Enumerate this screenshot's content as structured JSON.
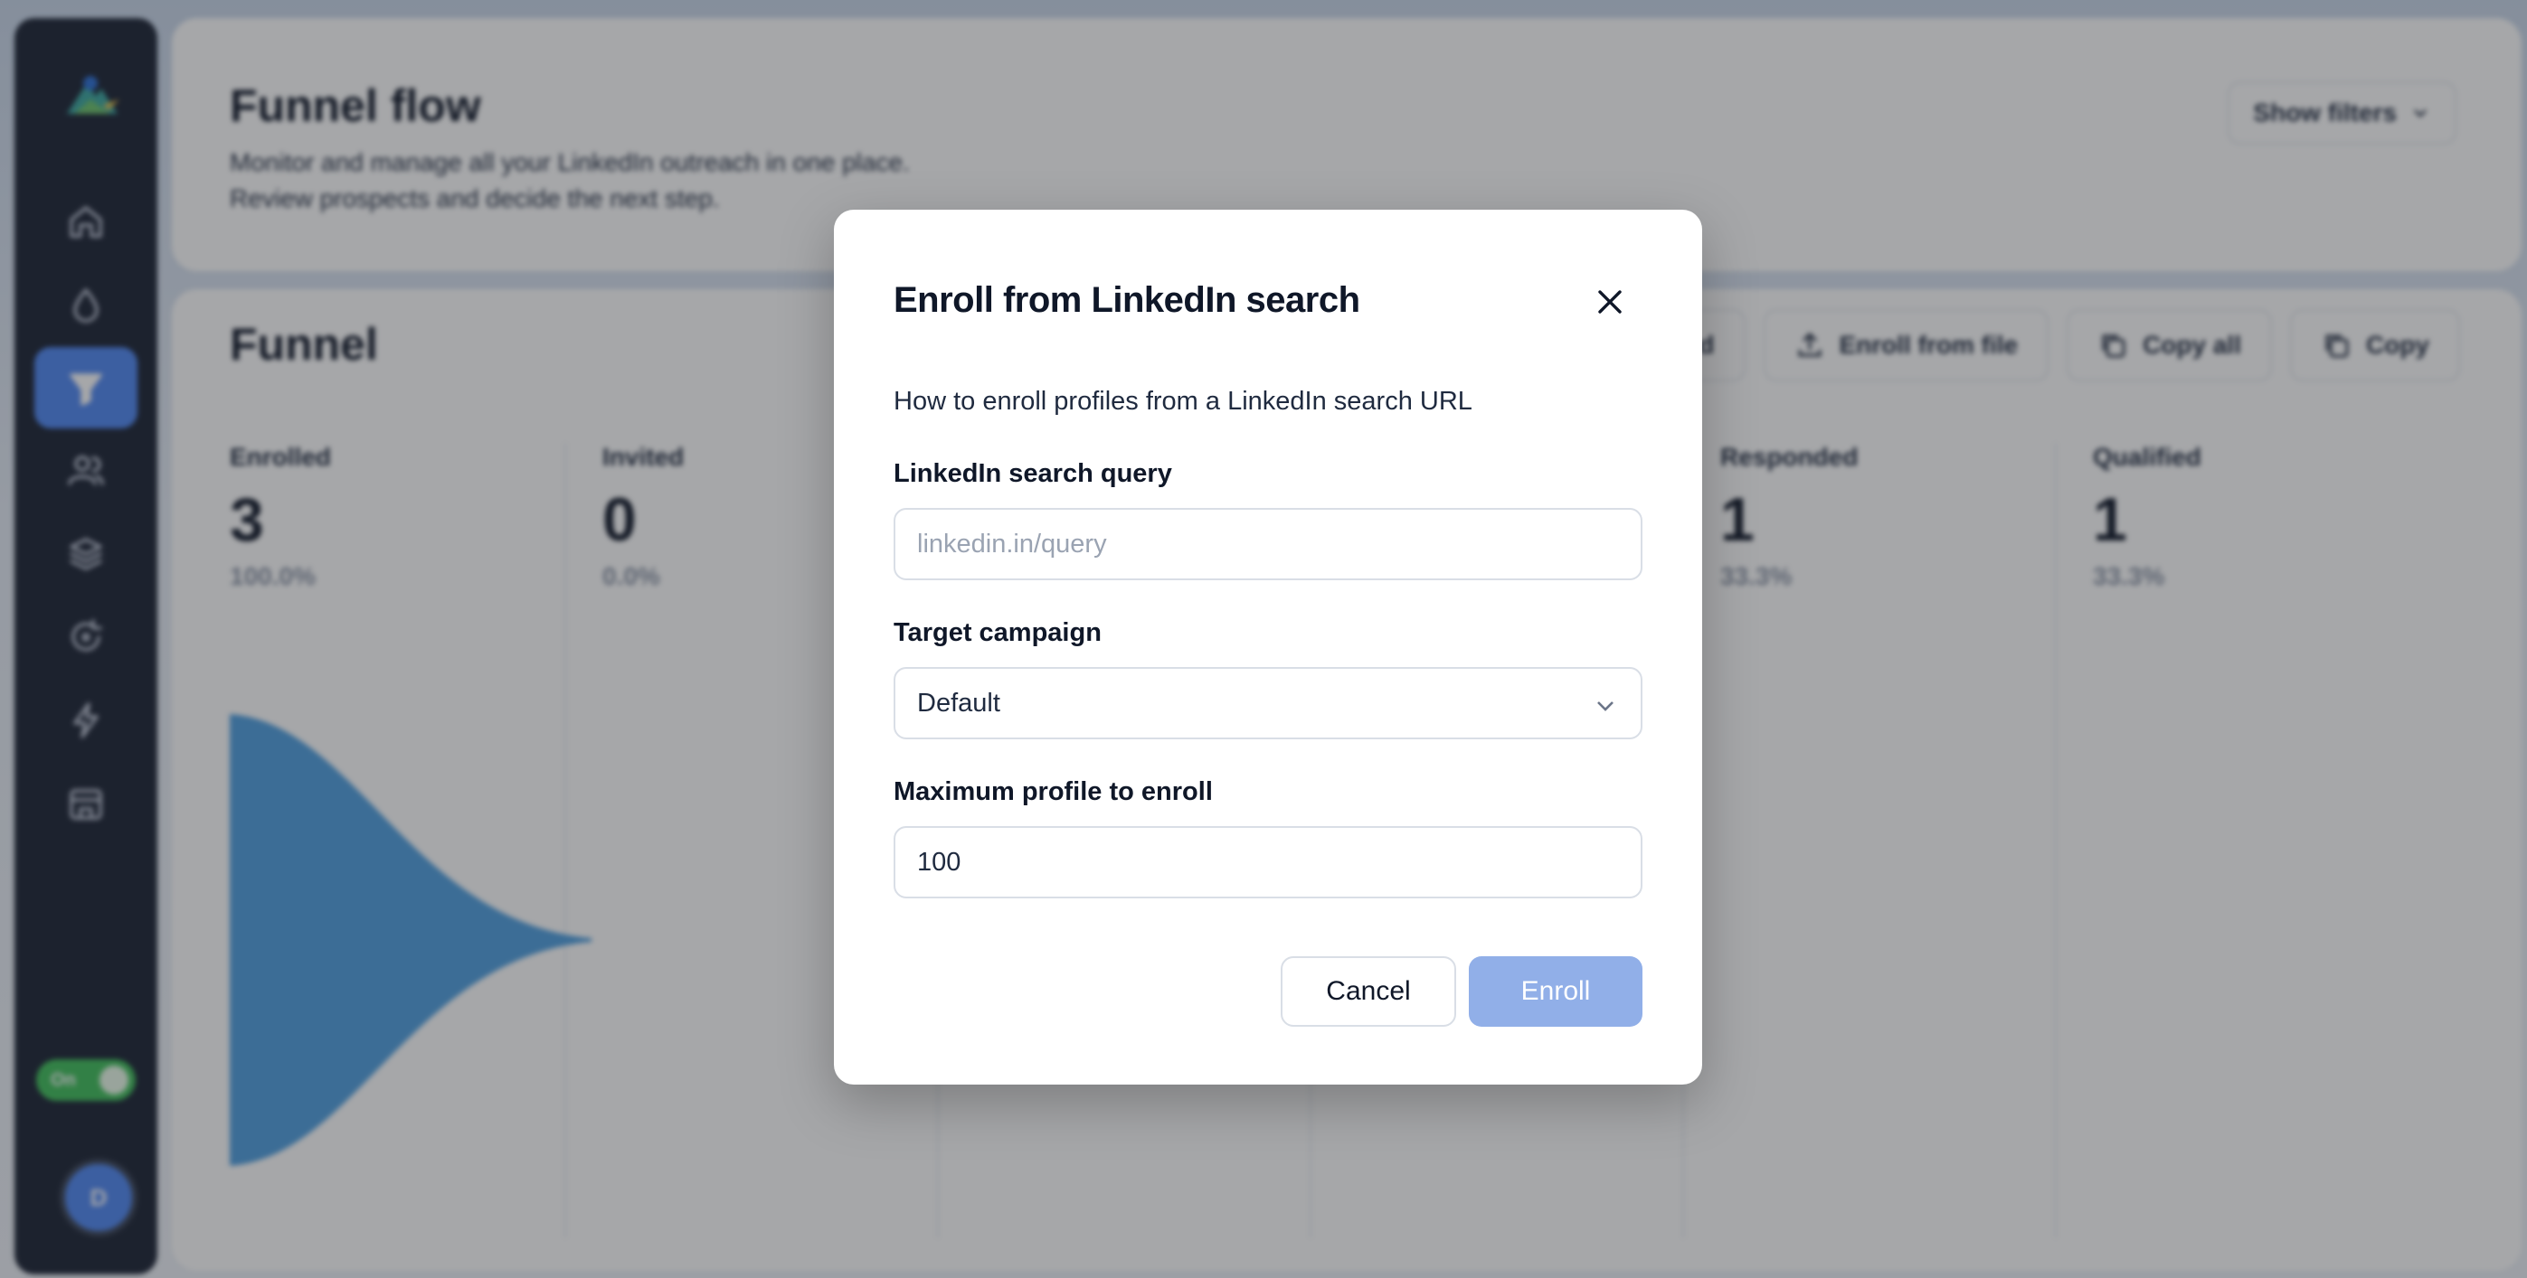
{
  "colors": {
    "accent": "#4f87f2",
    "sidebar": "#1a2233",
    "funnel": "#4f9fe0",
    "enroll_disabled": "#91afe8",
    "toggle_on": "#3fbf5a"
  },
  "sidebar": {
    "items": [
      {
        "icon": "home-icon",
        "active": false
      },
      {
        "icon": "drop-icon",
        "active": false
      },
      {
        "icon": "funnel-icon",
        "active": true
      },
      {
        "icon": "users-icon",
        "active": false
      },
      {
        "icon": "layers-icon",
        "active": false
      },
      {
        "icon": "refresh-icon",
        "active": false
      },
      {
        "icon": "bolt-icon",
        "active": false
      },
      {
        "icon": "store-icon",
        "active": false
      }
    ],
    "toggle_label": "On",
    "avatar_initial": "D"
  },
  "header": {
    "title": "Funnel flow",
    "subtitle_line1": "Monitor and manage all your LinkedIn outreach in one place.",
    "subtitle_line2": "Review prospects and decide the next step.",
    "show_filters": "Show filters"
  },
  "funnel": {
    "title": "Funnel",
    "toolbar": {
      "clipboard": "board",
      "enroll_file": "Enroll from file",
      "copy_all": "Copy all",
      "copy": "Copy"
    },
    "stages": [
      {
        "label": "Enrolled",
        "count": "3",
        "pct": "100.0%"
      },
      {
        "label": "Invited",
        "count": "0",
        "pct": "0.0%"
      },
      {
        "label": "",
        "count": "",
        "pct": ""
      },
      {
        "label": "",
        "count": "",
        "pct": ""
      },
      {
        "label": "Responded",
        "count": "1",
        "pct": "33.3%"
      },
      {
        "label": "Qualified",
        "count": "1",
        "pct": "33.3%"
      }
    ]
  },
  "modal": {
    "title": "Enroll from LinkedIn search",
    "description": "How to enroll profiles from a LinkedIn search URL",
    "query_label": "LinkedIn search query",
    "query_placeholder": "linkedin.in/query",
    "query_value": "",
    "campaign_label": "Target campaign",
    "campaign_value": "Default",
    "max_label": "Maximum profile to enroll",
    "max_value": "100",
    "cancel": "Cancel",
    "enroll": "Enroll"
  }
}
